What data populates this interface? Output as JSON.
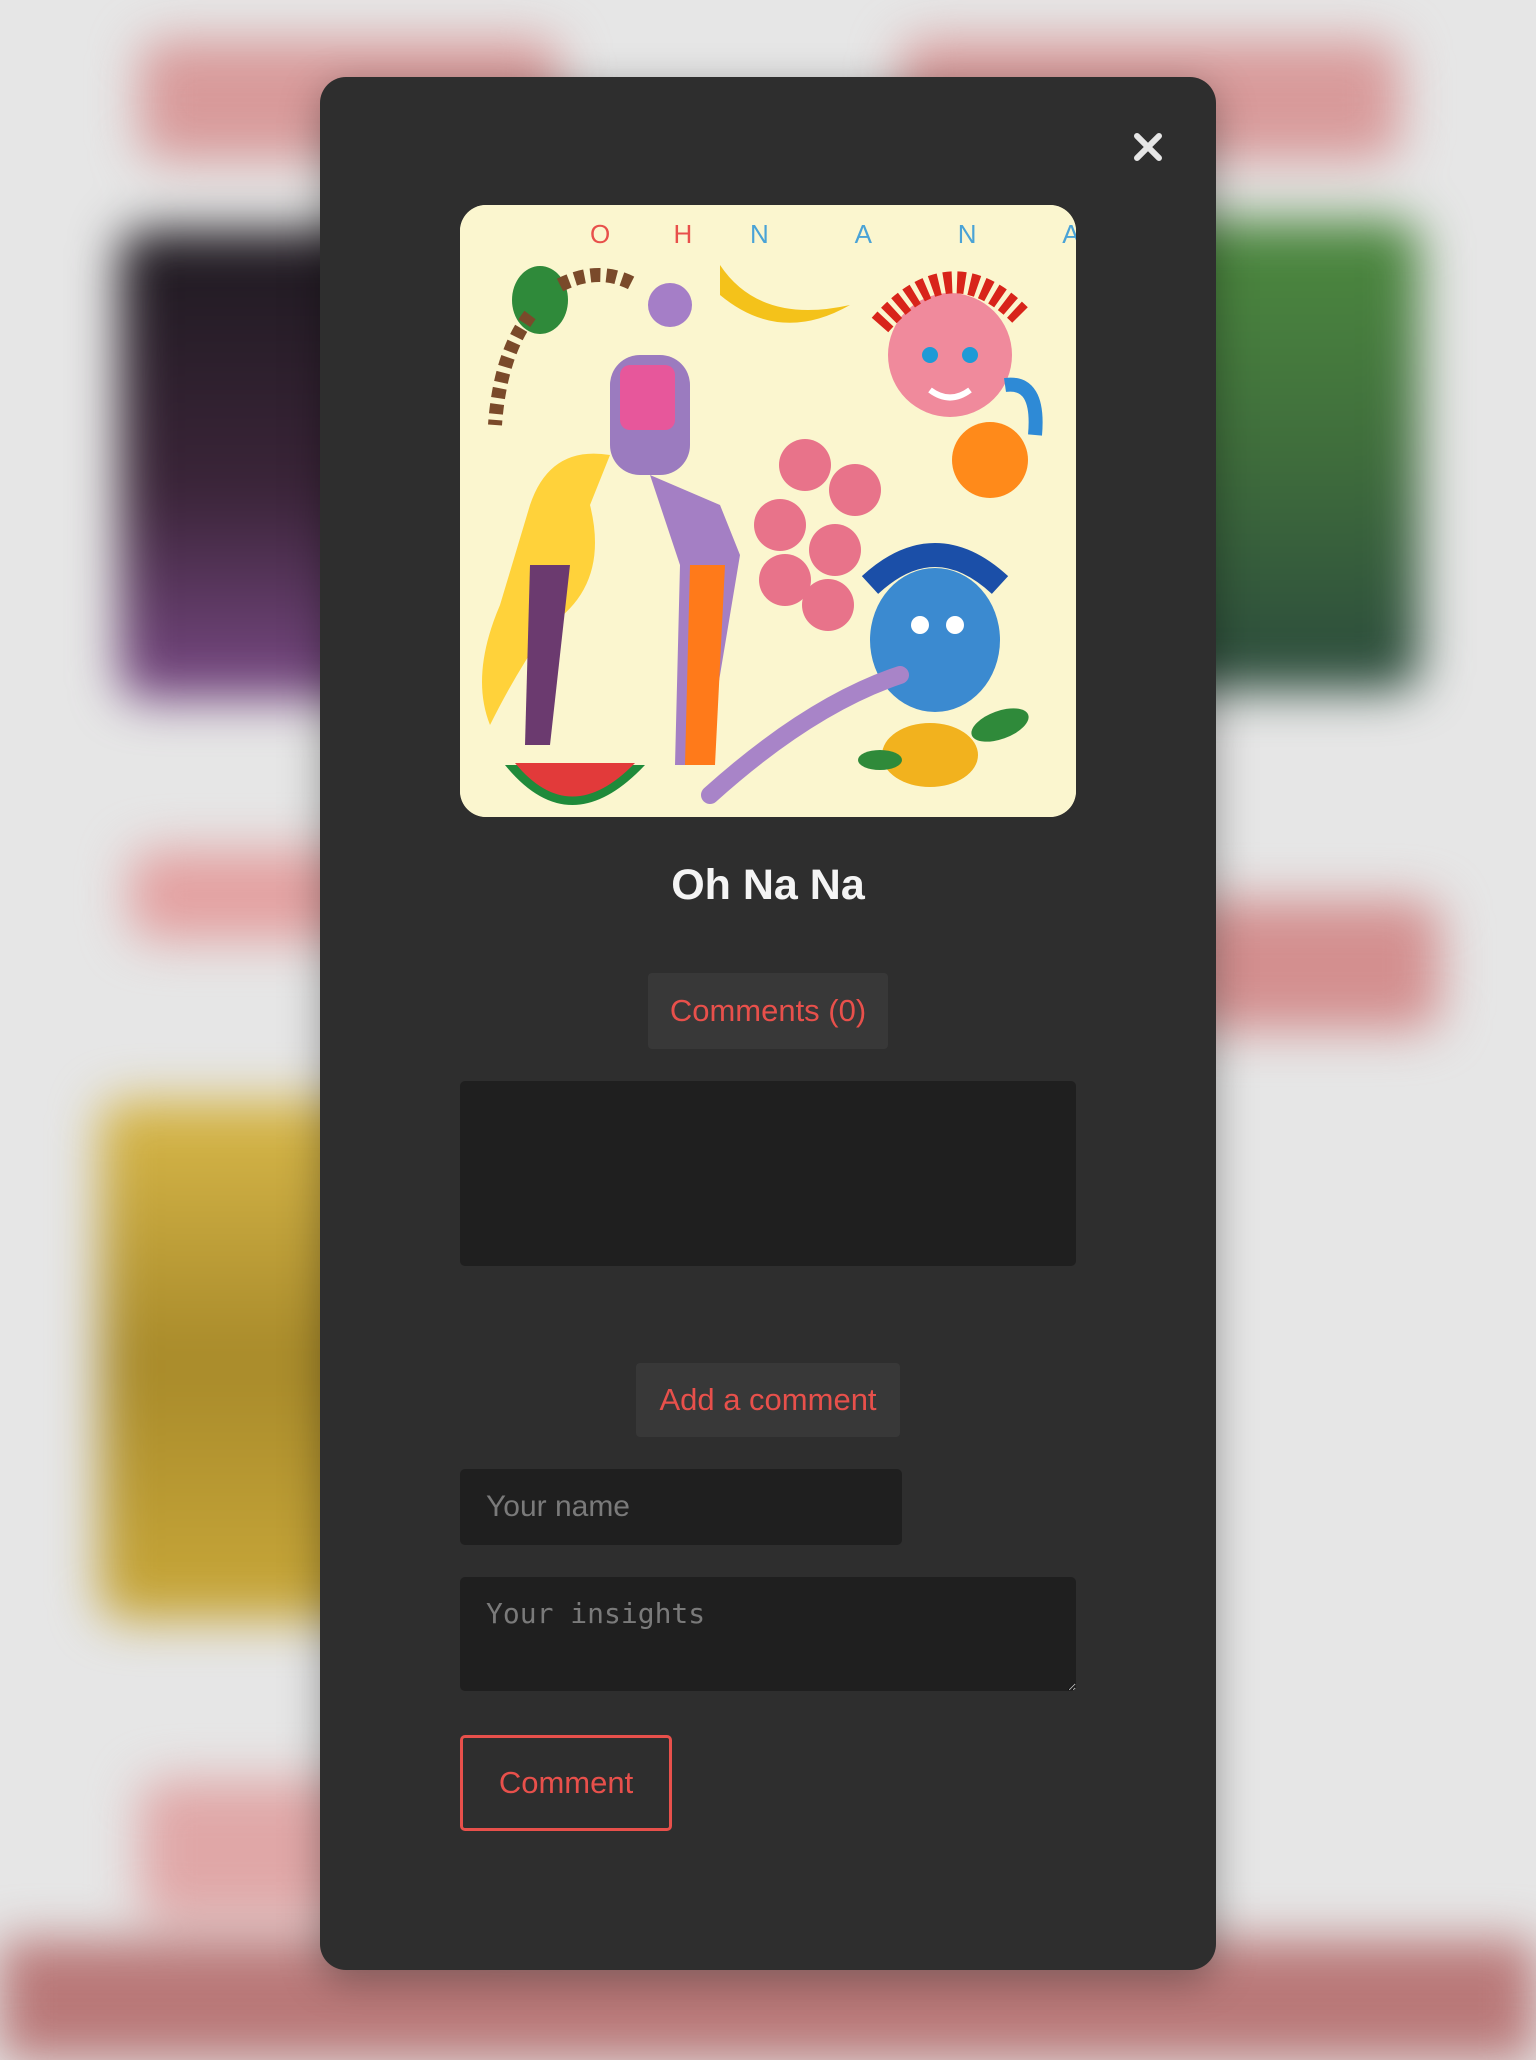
{
  "modal": {
    "close_icon": "close-icon",
    "artwork_text": "O H N A N A",
    "title": "Oh Na Na",
    "comments_tab": "Comments (0)",
    "add_comment_label": "Add a comment",
    "name_placeholder": "Your name",
    "insights_placeholder": "Your insights",
    "submit_label": "Comment"
  },
  "colors": {
    "accent": "#e8504b",
    "modal_bg": "#2e2e2e",
    "field_bg": "#1f1f1f",
    "cover_bg": "#fbf6cf"
  }
}
